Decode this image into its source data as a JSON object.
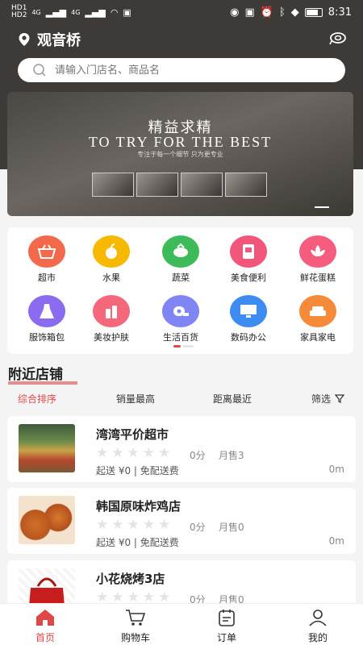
{
  "status": {
    "time": "8:31",
    "carriers": [
      "HD1",
      "HD2"
    ],
    "net_left": "4G",
    "net_right": "4G"
  },
  "header": {
    "location": "观音桥",
    "search_placeholder": "请输入门店名、商品名"
  },
  "banner": {
    "title_cn": "精益求精",
    "title_en": "TO TRY FOR THE BEST",
    "subtitle": "专注于每一个细节 只为更专业"
  },
  "categories": [
    {
      "label": "超市",
      "icon": "basket-icon",
      "color": "#f26a4b"
    },
    {
      "label": "水果",
      "icon": "apple-icon",
      "color": "#f7b900"
    },
    {
      "label": "蔬菜",
      "icon": "vegetable-icon",
      "color": "#3dbb5a"
    },
    {
      "label": "美食便利",
      "icon": "food-box-icon",
      "color": "#f2567a"
    },
    {
      "label": "鲜花蛋糕",
      "icon": "flower-icon",
      "color": "#f55c7e"
    },
    {
      "label": "服饰箱包",
      "icon": "dress-icon",
      "color": "#8b6cf0"
    },
    {
      "label": "美妆护肤",
      "icon": "cosmetics-icon",
      "color": "#f5687c"
    },
    {
      "label": "生活百货",
      "icon": "tissue-icon",
      "color": "#7f86f4"
    },
    {
      "label": "数码办公",
      "icon": "computer-icon",
      "color": "#3e8bf2"
    },
    {
      "label": "家具家电",
      "icon": "sofa-icon",
      "color": "#f58a3a"
    }
  ],
  "nearby": {
    "title": "附近店铺"
  },
  "sort": {
    "comprehensive": "综合排序",
    "sales": "销量最高",
    "distance": "距离最近",
    "filter": "筛选"
  },
  "stores": [
    {
      "name": "湾湾平价超市",
      "score": "0分",
      "sales": "月售3",
      "delivery": "起送 ¥0  |  免配送费",
      "distance": "0m",
      "rating": 0
    },
    {
      "name": "韩国原味炸鸡店",
      "score": "0分",
      "sales": "月售0",
      "delivery": "起送 ¥0  |  免配送费",
      "distance": "0m",
      "rating": 0
    },
    {
      "name": "小花烧烤3店",
      "score": "0分",
      "sales": "月售0",
      "delivery": "",
      "distance": "",
      "rating": 0
    }
  ],
  "tabs": [
    {
      "label": "首页",
      "icon": "home-icon"
    },
    {
      "label": "购物车",
      "icon": "cart-icon"
    },
    {
      "label": "订单",
      "icon": "order-icon"
    },
    {
      "label": "我的",
      "icon": "profile-icon"
    }
  ],
  "colors": {
    "accent": "#e04848",
    "header_bg": "#3d3a37"
  }
}
